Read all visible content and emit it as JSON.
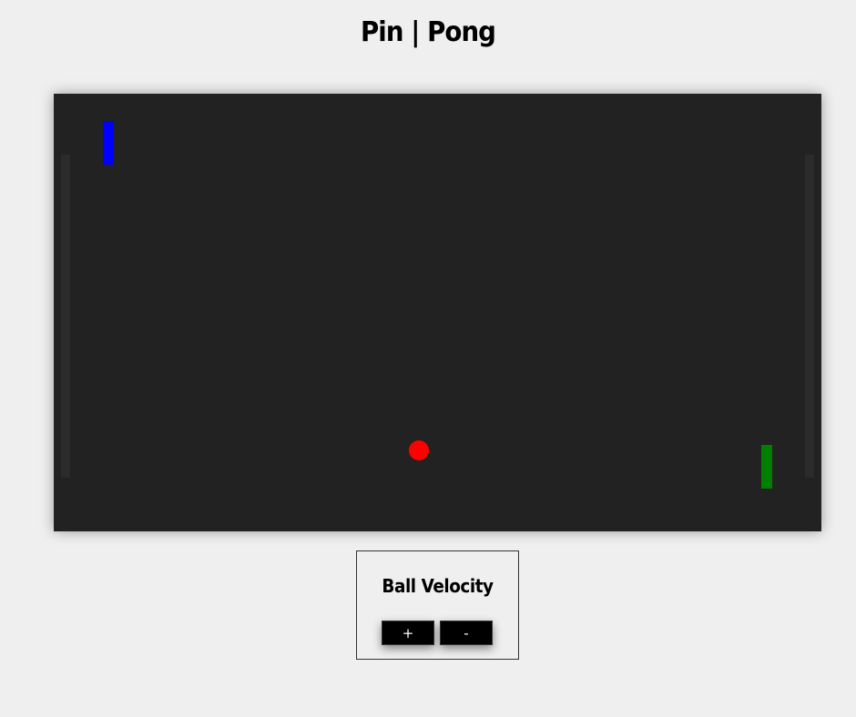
{
  "header": {
    "title": "Pin | Pong"
  },
  "game": {
    "board_color": "#222222",
    "rail_color": "#2b2b2b",
    "left_paddle_color": "#0000ff",
    "right_paddle_color": "#008000",
    "ball_color": "#ff0000"
  },
  "controls": {
    "title": "Ball Velocity",
    "increase_label": "+",
    "decrease_label": "-"
  }
}
